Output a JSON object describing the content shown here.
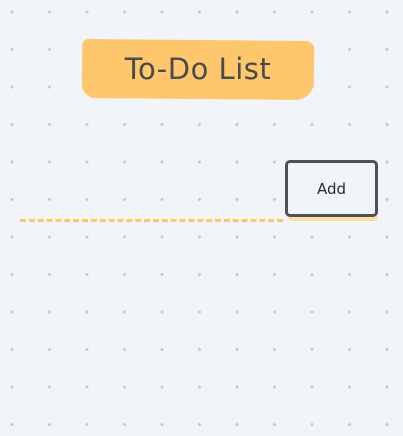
{
  "app": {
    "title": "To-Do List"
  },
  "input": {
    "value": "",
    "placeholder": ""
  },
  "add_button": {
    "label": "Add"
  },
  "colors": {
    "background": "#f1f4f8",
    "dot": "#c4c8cf",
    "accent": "#fec76e",
    "text": "#4b4b4b",
    "button_border": "#505155"
  }
}
